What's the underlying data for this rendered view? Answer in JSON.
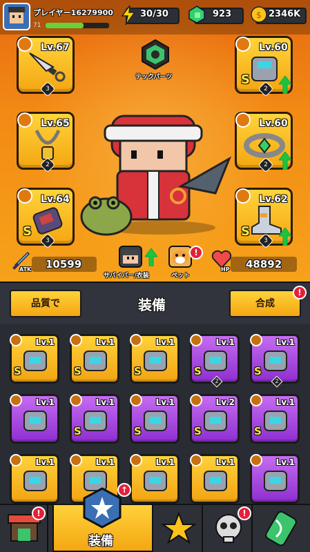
{
  "player": {
    "name": "プレイヤー16279900",
    "level": "71"
  },
  "resources": {
    "energy": "30/30",
    "gems": "923",
    "coins": "2346K"
  },
  "tech_parts": {
    "label": "テックパーツ"
  },
  "slots_left": [
    {
      "level": "Lv.67",
      "count": "3",
      "rank": ""
    },
    {
      "level": "Lv.65",
      "count": "2",
      "rank": ""
    },
    {
      "level": "Lv.64",
      "count": "3",
      "rank": "S"
    }
  ],
  "slots_right": [
    {
      "level": "Lv.60",
      "count": "2",
      "rank": "S"
    },
    {
      "level": "Lv.60",
      "count": "2",
      "rank": ""
    },
    {
      "level": "Lv.62",
      "count": "3",
      "rank": "S"
    }
  ],
  "stats": {
    "atk_label": "ATK",
    "atk": "10599",
    "hp_label": "HP",
    "hp": "48892"
  },
  "companions": {
    "survivor_label": "サバイバー/衣装",
    "pet_label": "ペット"
  },
  "toolbar": {
    "quality_label": "品質で",
    "title": "装備",
    "merge_label": "合成"
  },
  "inventory": [
    {
      "level": "Lv.1",
      "rank": "S",
      "color": "gold",
      "count": ""
    },
    {
      "level": "Lv.1",
      "rank": "S",
      "color": "gold",
      "count": ""
    },
    {
      "level": "Lv.1",
      "rank": "S",
      "color": "gold",
      "count": ""
    },
    {
      "level": "Lv.1",
      "rank": "S",
      "color": "purple",
      "count": "2"
    },
    {
      "level": "Lv.1",
      "rank": "S",
      "color": "purple",
      "count": "2"
    },
    {
      "level": "Lv.1",
      "rank": "",
      "color": "purple",
      "count": ""
    },
    {
      "level": "Lv.1",
      "rank": "S",
      "color": "purple",
      "count": ""
    },
    {
      "level": "Lv.1",
      "rank": "S",
      "color": "purple",
      "count": ""
    },
    {
      "level": "Lv.2",
      "rank": "S",
      "color": "purple",
      "count": ""
    },
    {
      "level": "Lv.1",
      "rank": "S",
      "color": "purple",
      "count": ""
    },
    {
      "level": "Lv.1",
      "rank": "",
      "color": "gold",
      "count": ""
    },
    {
      "level": "Lv.1",
      "rank": "",
      "color": "gold",
      "count": ""
    },
    {
      "level": "Lv.1",
      "rank": "",
      "color": "gold",
      "count": ""
    },
    {
      "level": "Lv.1",
      "rank": "",
      "color": "gold",
      "count": ""
    },
    {
      "level": "Lv.1",
      "rank": "",
      "color": "purple",
      "count": ""
    }
  ],
  "tabs": {
    "equipment_label": "装備",
    "badge": "!"
  },
  "colors": {
    "accent": "#f4a612",
    "purple": "#9a3ad8",
    "bg": "#2a2c33",
    "alert": "#e5203a"
  }
}
